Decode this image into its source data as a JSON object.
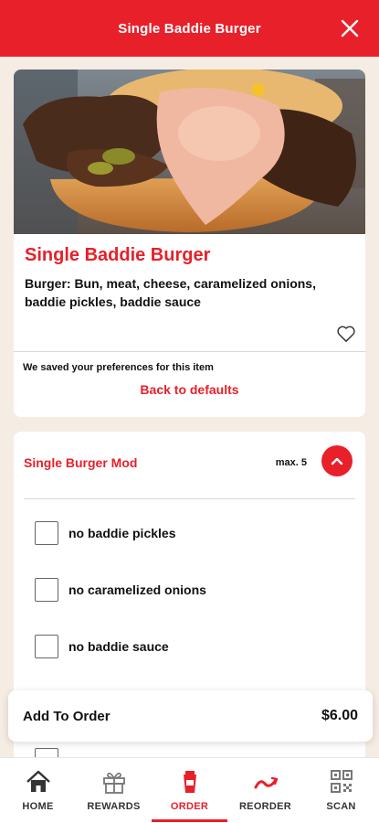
{
  "header": {
    "title": "Single Baddie Burger"
  },
  "item": {
    "title": "Single Baddie Burger",
    "description": "Burger: Bun, meat, cheese, caramelized onions, baddie pickles, baddie sauce",
    "saved_note": "We saved your preferences for this item",
    "back_link": "Back to defaults"
  },
  "modifier": {
    "title": "Single Burger Mod",
    "max": "max. 5",
    "options": [
      {
        "label": "no baddie pickles",
        "checked": false
      },
      {
        "label": "no caramelized onions",
        "checked": false
      },
      {
        "label": "no baddie sauce",
        "checked": false
      }
    ]
  },
  "add_to_order": {
    "label": "Add To Order",
    "price": "$6.00"
  },
  "nav": {
    "items": [
      {
        "label": "HOME",
        "icon": "home-icon"
      },
      {
        "label": "REWARDS",
        "icon": "gift-icon"
      },
      {
        "label": "ORDER",
        "icon": "order-icon",
        "active": true
      },
      {
        "label": "REORDER",
        "icon": "reorder-icon"
      },
      {
        "label": "SCAN",
        "icon": "qr-code-icon"
      }
    ]
  },
  "colors": {
    "brand_red": "#e8202a",
    "background": "#f5ede3"
  }
}
